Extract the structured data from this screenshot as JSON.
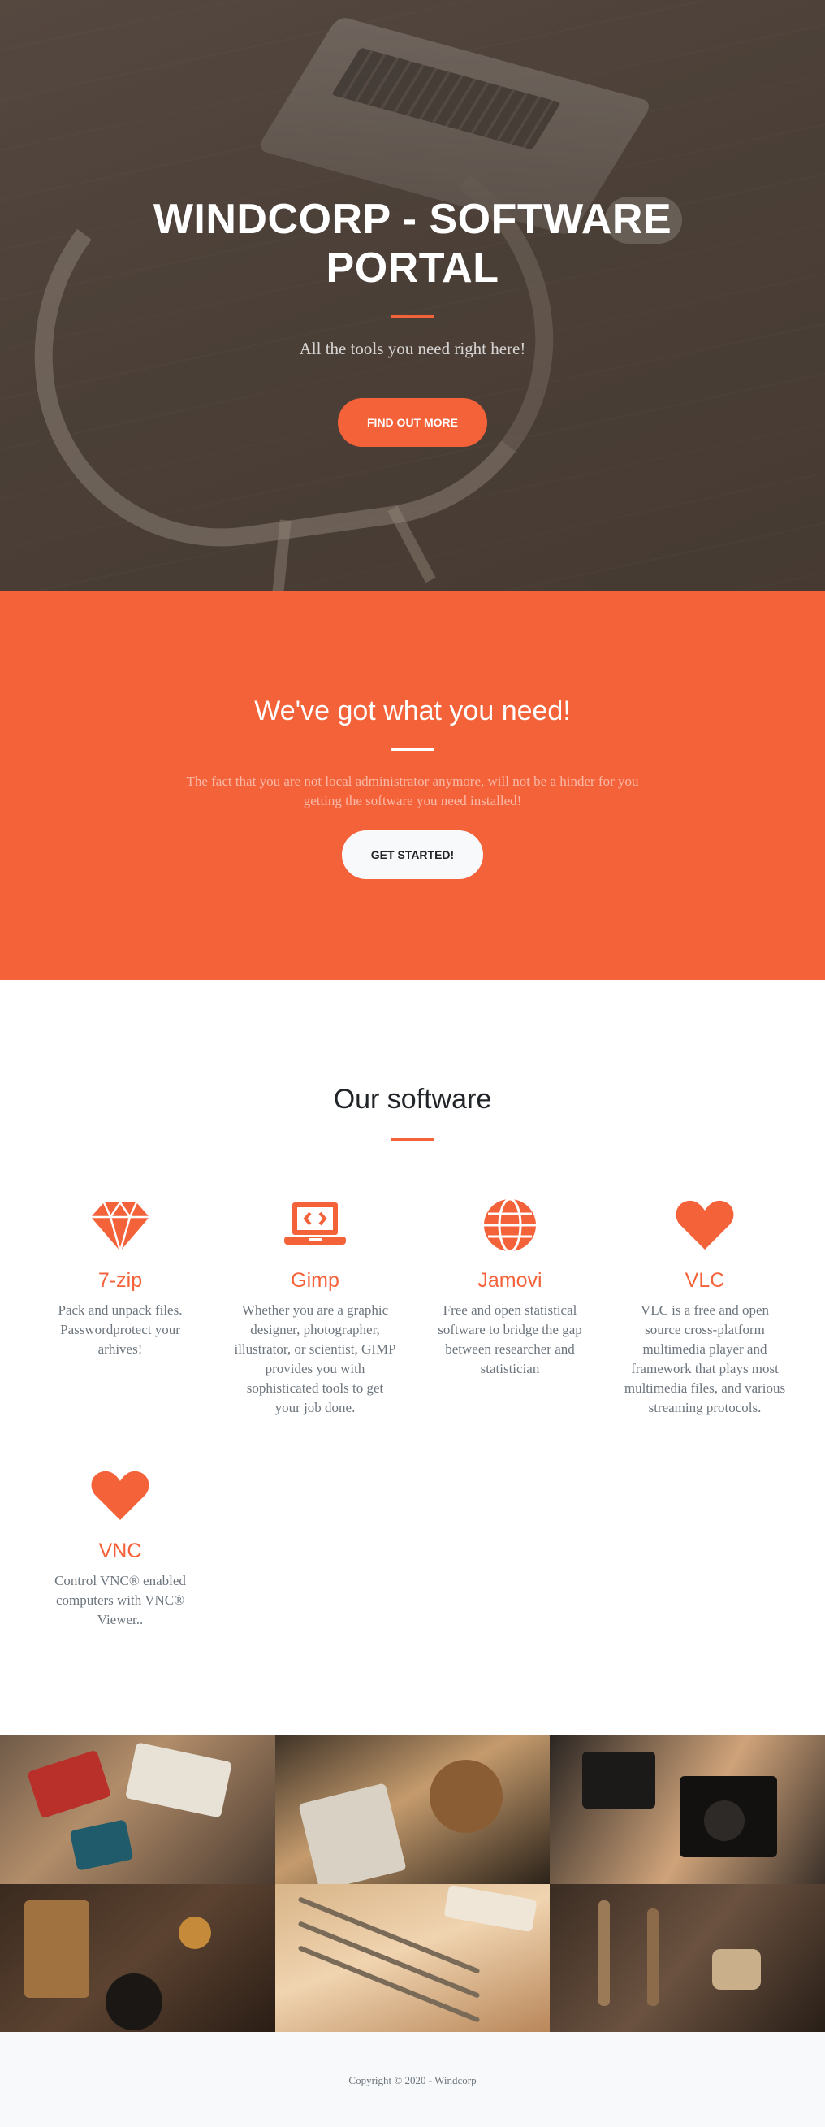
{
  "hero": {
    "title": "WINDCORP - SOFTWARE PORTAL",
    "subtitle": "All the tools you need right here!",
    "cta_label": "FIND OUT MORE"
  },
  "about": {
    "title": "We've got what you need!",
    "text": "The fact that you are not local administrator anymore, will not be a hinder for you getting the software you need installed!",
    "cta_label": "GET STARTED!"
  },
  "services": {
    "title": "Our software",
    "items": [
      {
        "name": "7-zip",
        "icon": "gem-icon",
        "description": "Pack and unpack files. Passwordprotect your arhives!"
      },
      {
        "name": "Gimp",
        "icon": "laptop-code-icon",
        "description": "Whether you are a graphic designer, photographer, illustrator, or scientist, GIMP provides you with sophisticated tools to get your job done."
      },
      {
        "name": "Jamovi",
        "icon": "globe-icon",
        "description": "Free and open statistical software to bridge the gap between researcher and statistician"
      },
      {
        "name": "VLC",
        "icon": "heart-icon",
        "description": "VLC is a free and open source cross-platform multimedia player and framework that plays most multimedia files, and various streaming protocols."
      },
      {
        "name": "VNC",
        "icon": "heart-icon",
        "description": "Control VNC® enabled computers with VNC® Viewer.."
      }
    ]
  },
  "portfolio": {
    "tiles": [
      "craft-supplies-photo",
      "coasters-photo",
      "camera-photo",
      "kitchen-photo",
      "pencils-photo",
      "tools-photo"
    ]
  },
  "footer": {
    "copyright": "Copyright © 2020 - Windcorp"
  },
  "colors": {
    "accent": "#f4623a",
    "text_muted": "#6c757d",
    "light": "#f8f9fa"
  }
}
